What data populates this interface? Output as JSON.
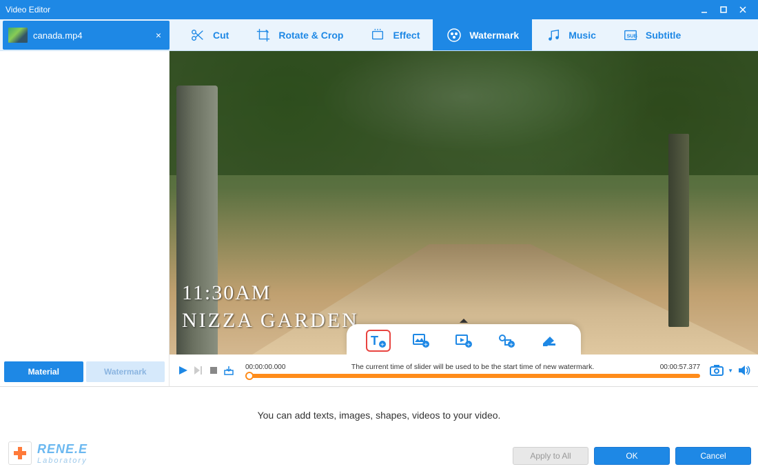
{
  "window": {
    "title": "Video Editor"
  },
  "file_tab": {
    "name": "canada.mp4"
  },
  "tool_tabs": [
    {
      "id": "cut",
      "label": "Cut"
    },
    {
      "id": "rotate",
      "label": "Rotate & Crop"
    },
    {
      "id": "effect",
      "label": "Effect"
    },
    {
      "id": "watermark",
      "label": "Watermark",
      "active": true
    },
    {
      "id": "music",
      "label": "Music"
    },
    {
      "id": "subtitle",
      "label": "Subtitle"
    }
  ],
  "side_tabs": {
    "material": "Material",
    "watermark": "Watermark"
  },
  "preview": {
    "overlay_time": "11:30AM",
    "overlay_title": "NIZZA GARDEN"
  },
  "watermark_types": [
    {
      "id": "text",
      "name": "add-text-watermark",
      "selected": true
    },
    {
      "id": "image",
      "name": "add-image-watermark"
    },
    {
      "id": "video",
      "name": "add-video-watermark"
    },
    {
      "id": "shape",
      "name": "add-shape-watermark"
    },
    {
      "id": "remove",
      "name": "remove-watermark"
    }
  ],
  "playback": {
    "current_time": "00:00:00.000",
    "total_time": "00:00:57.377",
    "hint": "The current time of slider will be used to be the start time of new watermark."
  },
  "panel": {
    "empty_hint": "You can add texts, images, shapes, videos to your video."
  },
  "buttons": {
    "apply_all": "Apply to All",
    "ok": "OK",
    "cancel": "Cancel"
  },
  "brand": {
    "name": "RENE.E",
    "sub": "Laboratory"
  }
}
